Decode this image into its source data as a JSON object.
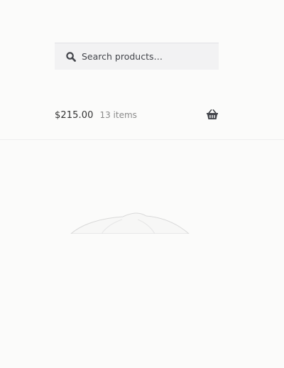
{
  "search": {
    "placeholder": "Search products…",
    "icon": "search-icon"
  },
  "cart": {
    "amount": "$215.00",
    "count": "13 items",
    "icon": "basket-icon"
  },
  "colors": {
    "background": "#fbfbfa",
    "search_bg": "#f2f2f3",
    "text_dark": "#333333",
    "text_muted": "#8a8a8a",
    "icon": "#43454b"
  }
}
